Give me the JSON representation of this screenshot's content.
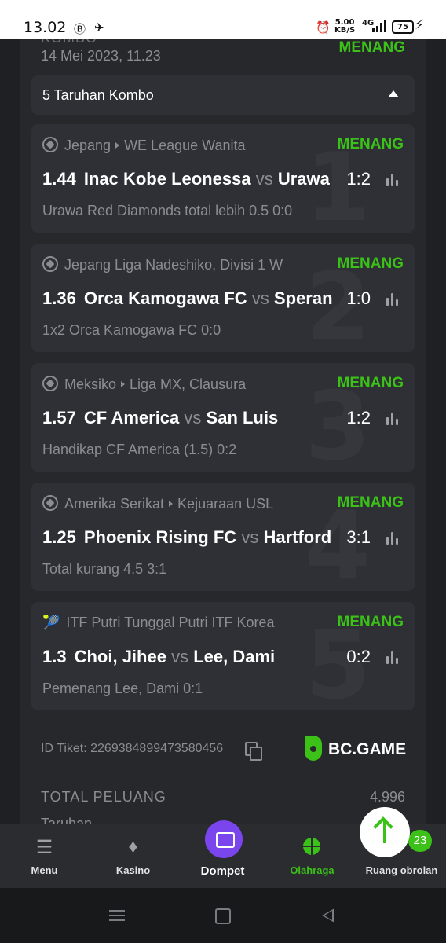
{
  "status_bar": {
    "time": "13.02",
    "speed_value": "5.00",
    "speed_unit": "KB/S",
    "network": "4G",
    "battery": "75"
  },
  "ticket": {
    "type_label": "KOMBO",
    "date": "14 Mei 2023, 11.23",
    "status": "MENANG",
    "combo_title": "5 Taruhan Kombo",
    "id_label": "ID Tiket: 2269384899473580456",
    "brand": "BC.GAME",
    "total_odds_label": "TOTAL PELUANG",
    "total_odds_value": "4.996",
    "bet_label": "Taruhan"
  },
  "bets": [
    {
      "number": "1",
      "country": "Jepang",
      "league": "WE League Wanita",
      "status": "MENANG",
      "odds": "1.44",
      "home": "Inac Kobe Leonessa",
      "vs": "vs",
      "away": "Urawa",
      "score": "1:2",
      "market": "Urawa Red Diamonds total lebih 0.5  0:0"
    },
    {
      "number": "2",
      "country": "Jepang Liga Nadeshiko, Divisi 1 W",
      "league": "",
      "status": "MENANG",
      "odds": "1.36",
      "home": "Orca Kamogawa FC",
      "vs": "vs",
      "away": "Speran",
      "score": "1:0",
      "market": "1x2 Orca Kamogawa FC  0:0"
    },
    {
      "number": "3",
      "country": "Meksiko",
      "league": "Liga MX, Clausura",
      "status": "MENANG",
      "odds": "1.57",
      "home": "CF America",
      "vs": "vs",
      "away": "San Luis",
      "score": "1:2",
      "market": "Handikap CF America (1.5)  0:2"
    },
    {
      "number": "4",
      "country": "Amerika Serikat",
      "league": "Kejuaraan USL",
      "status": "MENANG",
      "odds": "1.25",
      "home": "Phoenix Rising FC",
      "vs": "vs",
      "away": "Hartford",
      "score": "3:1",
      "market": "Total kurang 4.5  3:1"
    },
    {
      "number": "5",
      "country": "ITF Putri Tunggal Putri ITF Korea",
      "league": "",
      "status": "MENANG",
      "odds": "1.3",
      "home": "Choi, Jihee",
      "vs": "vs",
      "away": "Lee, Dami",
      "score": "0:2",
      "market": "Pemenang Lee, Dami  0:1"
    }
  ],
  "bottom_nav": {
    "menu": "Menu",
    "casino": "Kasino",
    "wallet": "Dompet",
    "sports": "Olahraga",
    "chat": "Ruang obrolan",
    "chat_badge": "23"
  },
  "icons": {
    "soccer": "soccer-ball-icon",
    "tennis": "tennis-racket-icon",
    "stats": "bar-chart-icon",
    "copy": "copy-icon",
    "scroll_top": "arrow-up-icon"
  },
  "colors": {
    "win": "#3bc117",
    "background": "#1e2023",
    "card": "#2e3035",
    "wallet_accent": "#7b45ee"
  }
}
